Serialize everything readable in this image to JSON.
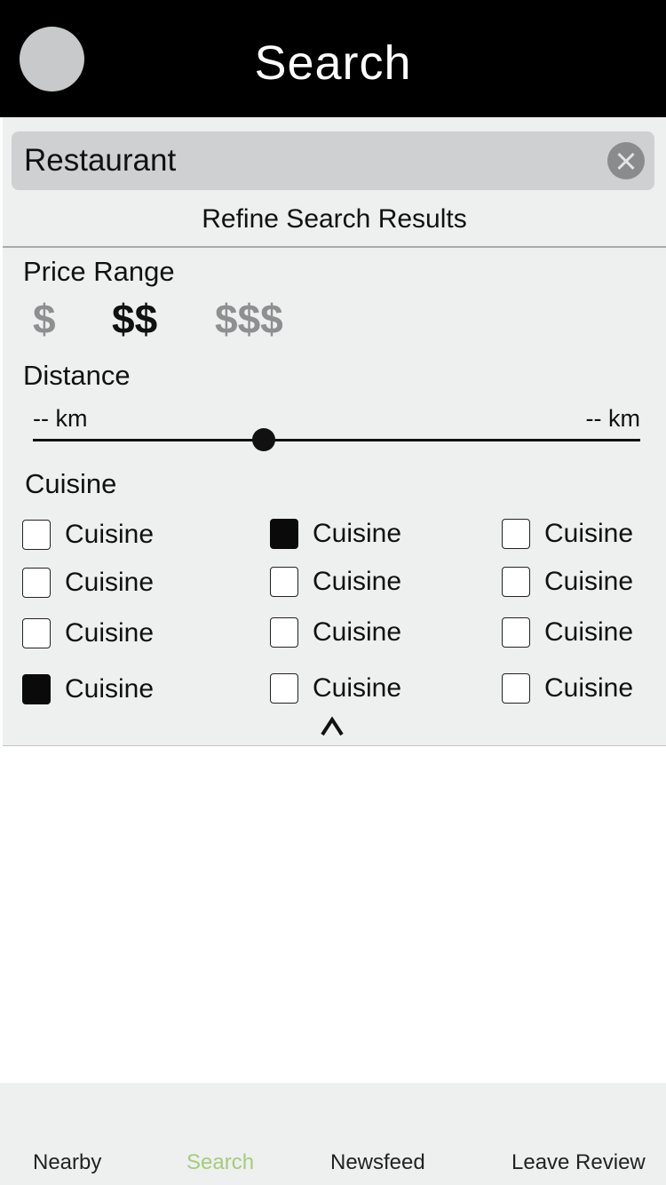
{
  "header": {
    "title": "Search"
  },
  "search": {
    "query": "Restaurant"
  },
  "refine": {
    "title": "Refine Search Results"
  },
  "price_range": {
    "label": "Price Range",
    "options": [
      "$",
      "$$",
      "$$$"
    ],
    "selected": "$$"
  },
  "distance": {
    "label": "Distance",
    "min_label": "-- km",
    "max_label": "-- km",
    "value_fraction": 0.38
  },
  "cuisine": {
    "label": "Cuisine",
    "items": [
      {
        "label": "Cuisine",
        "checked": false
      },
      {
        "label": "Cuisine",
        "checked": true
      },
      {
        "label": "Cuisine",
        "checked": false
      },
      {
        "label": "Cuisine",
        "checked": false
      },
      {
        "label": "Cuisine",
        "checked": false
      },
      {
        "label": "Cuisine",
        "checked": false
      },
      {
        "label": "Cuisine",
        "checked": false
      },
      {
        "label": "Cuisine",
        "checked": false
      },
      {
        "label": "Cuisine",
        "checked": false
      },
      {
        "label": "Cuisine",
        "checked": true
      },
      {
        "label": "Cuisine",
        "checked": false
      },
      {
        "label": "Cuisine",
        "checked": false
      }
    ]
  },
  "tabs": [
    {
      "label": "Nearby",
      "active": false
    },
    {
      "label": "Search",
      "active": true
    },
    {
      "label": "Newsfeed",
      "active": false
    },
    {
      "label": "Leave Review",
      "active": false
    }
  ],
  "colors": {
    "header_bg": "#000000",
    "panel_bg": "#eeefef",
    "active_tab": "#a4cc7d"
  }
}
